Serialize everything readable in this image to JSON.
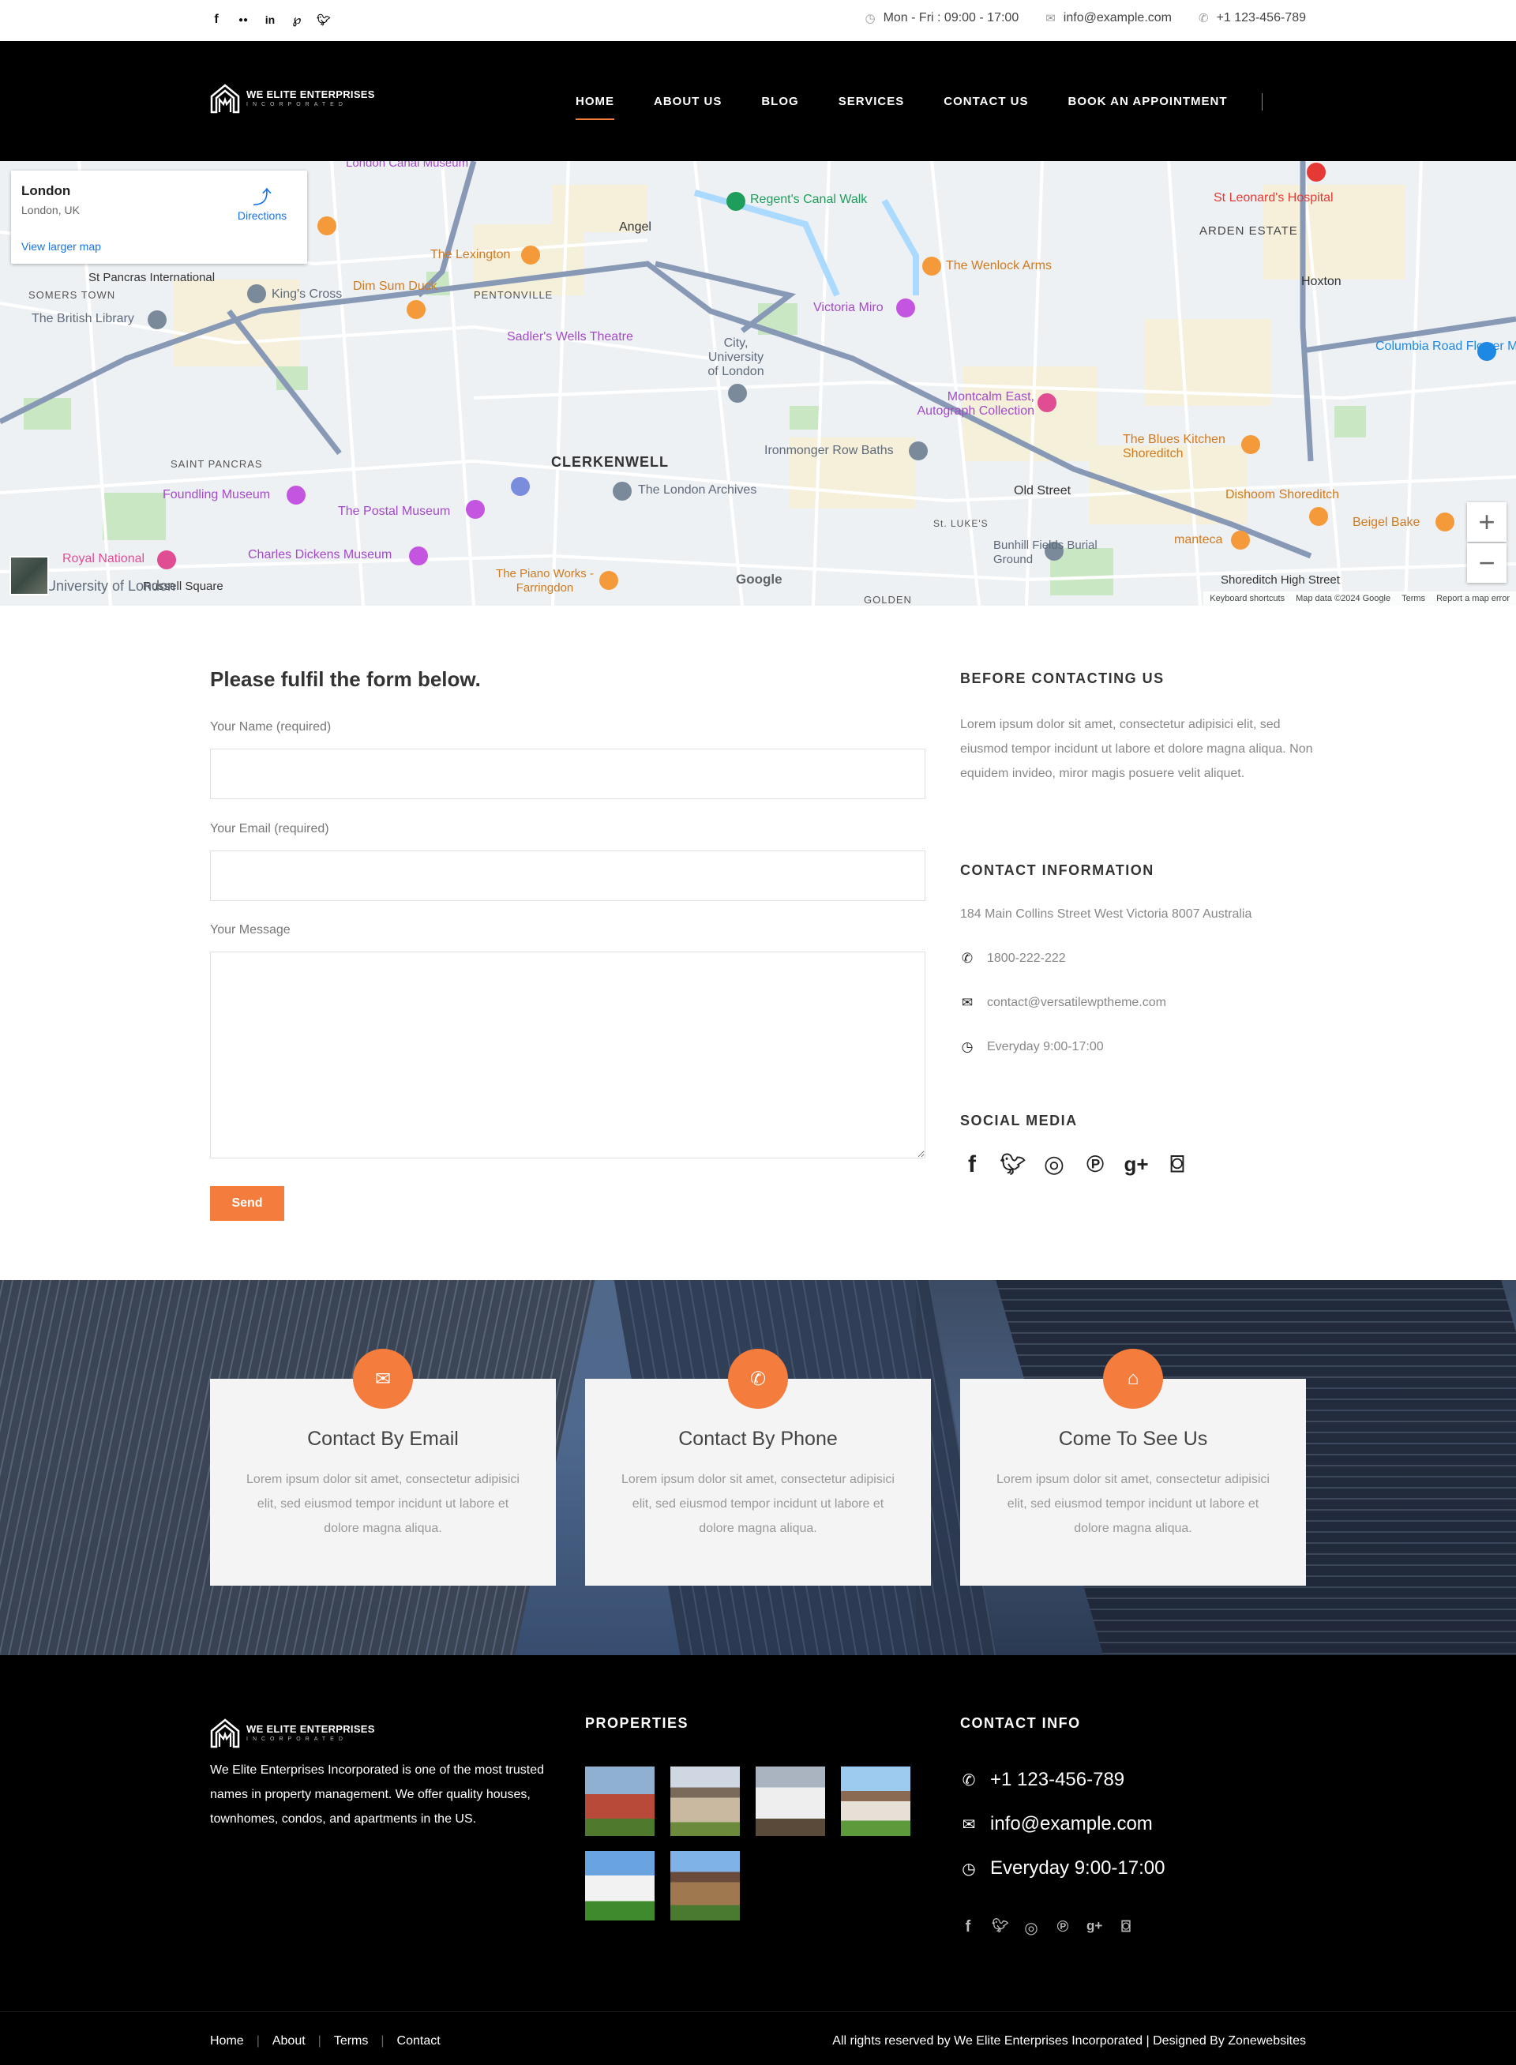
{
  "topbar": {
    "social_icons": [
      "facebook-icon",
      "flickr-icon",
      "linkedin-icon",
      "pinterest-icon",
      "twitter-icon"
    ],
    "hours": "Mon - Fri : 09:00 - 17:00",
    "email": "info@example.com",
    "phone": "+1 123-456-789"
  },
  "brand": {
    "name": "WE ELITE ENTERPRISES",
    "tagline": "INCORPORATED"
  },
  "nav": {
    "items": [
      "HOME",
      "ABOUT US",
      "BLOG",
      "SERVICES",
      "CONTACT US",
      "BOOK AN APPOINTMENT"
    ],
    "active": "HOME"
  },
  "map": {
    "place_title": "London",
    "place_subtitle": "London, UK",
    "directions": "Directions",
    "larger_map": "View larger map",
    "labels": [
      "London Canal Museum",
      "Regent's Canal Walk",
      "St Leonard's Hospital",
      "ARDEN ESTATE",
      "St Pancras International",
      "King's Cross",
      "Dim Sum Duck",
      "The Lexington",
      "PENTONVILLE",
      "Angel",
      "The Wenlock Arms",
      "Hoxton",
      "SOMERS TOWN",
      "The British Library",
      "Sadler's Wells Theatre",
      "Victoria Miro",
      "Columbia Road Flower Market",
      "City, University of London",
      "Montcalm East, Autograph Collection",
      "The Blues Kitchen Shoreditch",
      "CLERKENWELL",
      "Ironmonger Row Baths",
      "SAINT PANCRAS",
      "Foundling Museum",
      "The London Archives",
      "Old Street",
      "Dishoom Shoreditch",
      "The Postal Museum",
      "Beigel Bake",
      "Charles Dickens Museum",
      "Bunhill Fields Burial Ground",
      "manteca",
      "Royal National",
      "Russell Square",
      "The Piano Works - Farringdon",
      "Shoreditch High Street",
      "St. LUKE'S",
      "GOLDEN",
      "University of London"
    ],
    "footer": [
      "Keyboard shortcuts",
      "Map data ©2024 Google",
      "Terms",
      "Report a map error"
    ],
    "google": "Google"
  },
  "form": {
    "title": "Please fulfil the form below.",
    "name_label": "Your Name (required)",
    "email_label": "Your Email (required)",
    "message_label": "Your Message",
    "send": "Send"
  },
  "sidebar": {
    "before_heading": "BEFORE CONTACTING US",
    "before_text": "Lorem ipsum dolor sit amet, consectetur adipisici elit, sed eiusmod tempor incidunt ut labore et dolore magna aliqua. Non equidem invideo, miror magis posuere velit aliquet.",
    "contact_heading": "CONTACT INFORMATION",
    "address": "184 Main Collins Street West Victoria 8007 Australia",
    "phone": "1800-222-222",
    "email": "contact@versatilewptheme.com",
    "hours": "Everyday 9:00-17:00",
    "social_heading": "SOCIAL MEDIA",
    "social_icons": [
      "facebook-icon",
      "twitter-icon",
      "dribbble-icon",
      "pinterest-icon",
      "google-plus-icon",
      "instagram-icon"
    ]
  },
  "cards": [
    {
      "icon": "envelope-icon",
      "title": "Contact By Email",
      "text": "Lorem ipsum dolor sit amet, consectetur adipisici elit, sed eiusmod tempor incidunt ut labore et dolore magna aliqua."
    },
    {
      "icon": "phone-icon",
      "title": "Contact By Phone",
      "text": "Lorem ipsum dolor sit amet, consectetur adipisici elit, sed eiusmod tempor incidunt ut labore et dolore magna aliqua."
    },
    {
      "icon": "home-icon",
      "title": "Come To See Us",
      "text": "Lorem ipsum dolor sit amet, consectetur adipisici elit, sed eiusmod tempor incidunt ut labore et dolore magna aliqua."
    }
  ],
  "footer": {
    "description": "We Elite Enterprises Incorporated is one of the most trusted names in property management. We offer quality houses, townhomes, condos, and apartments in the US.",
    "properties_heading": "PROPERTIES",
    "contact_heading": "CONTACT INFO",
    "phone": "+1 123-456-789",
    "email": "info@example.com",
    "hours": "Everyday 9:00-17:00",
    "social_icons": [
      "facebook-icon",
      "twitter-icon",
      "dribbble-icon",
      "pinterest-icon",
      "google-plus-icon",
      "instagram-icon"
    ],
    "links": [
      "Home",
      "About",
      "Terms",
      "Contact"
    ],
    "copyright": "All rights reserved by We Elite Enterprises Incorporated | Designed By Zonewebsites"
  },
  "colors": {
    "accent": "#f47c3c",
    "header_bg": "#000000",
    "card_bg": "#f4f4f4"
  }
}
